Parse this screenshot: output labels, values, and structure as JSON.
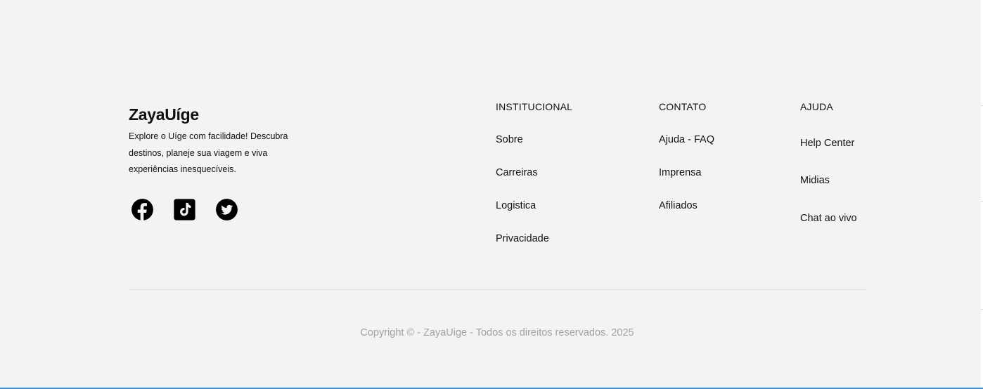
{
  "brand": {
    "title": "ZayaUíge",
    "description": "Explore o Uíge com facilidade! Descubra destinos, planeje sua viagem e viva experiências inesquecíveis."
  },
  "socials": [
    {
      "name": "facebook-icon"
    },
    {
      "name": "tiktok-icon"
    },
    {
      "name": "twitter-icon"
    }
  ],
  "columns": {
    "institucional": {
      "heading": "INSTITUCIONAL",
      "links": [
        "Sobre",
        "Carreiras",
        "Logistica",
        "Privacidade"
      ]
    },
    "contato": {
      "heading": "CONTATO",
      "links": [
        "Ajuda - FAQ",
        "Imprensa",
        "Afiliados"
      ]
    },
    "ajuda": {
      "heading": "AJUDA",
      "links": [
        "Help Center",
        "Midias",
        "Chat ao vivo"
      ]
    }
  },
  "copyright": "Copyright © - ZayaUige - Todos os direitos reservados. 2025",
  "colors": {
    "background": "#f3f3f3",
    "text": "#111111",
    "muted": "#a2a2a2",
    "divider": "#dedede",
    "accent_edge": "#3d8fe0"
  }
}
